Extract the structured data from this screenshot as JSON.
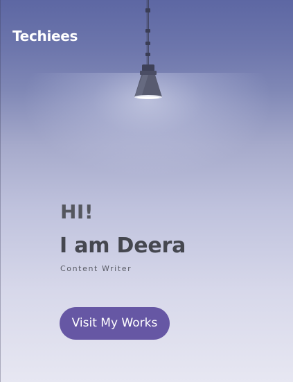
{
  "header": {
    "brand": "Techiees"
  },
  "hero": {
    "greeting": "HI!",
    "name": "I am Deera",
    "role": "Content Writer",
    "cta_label": "Visit My Works"
  },
  "icons": {
    "lamp": "pendant-lamp-icon"
  },
  "colors": {
    "background_top": "#5d67a3",
    "background_bottom": "#e7e7f2",
    "brand_text": "#ffffff",
    "heading_text": "#45474f",
    "button": "#6657a4",
    "button_text": "#ffffff"
  }
}
